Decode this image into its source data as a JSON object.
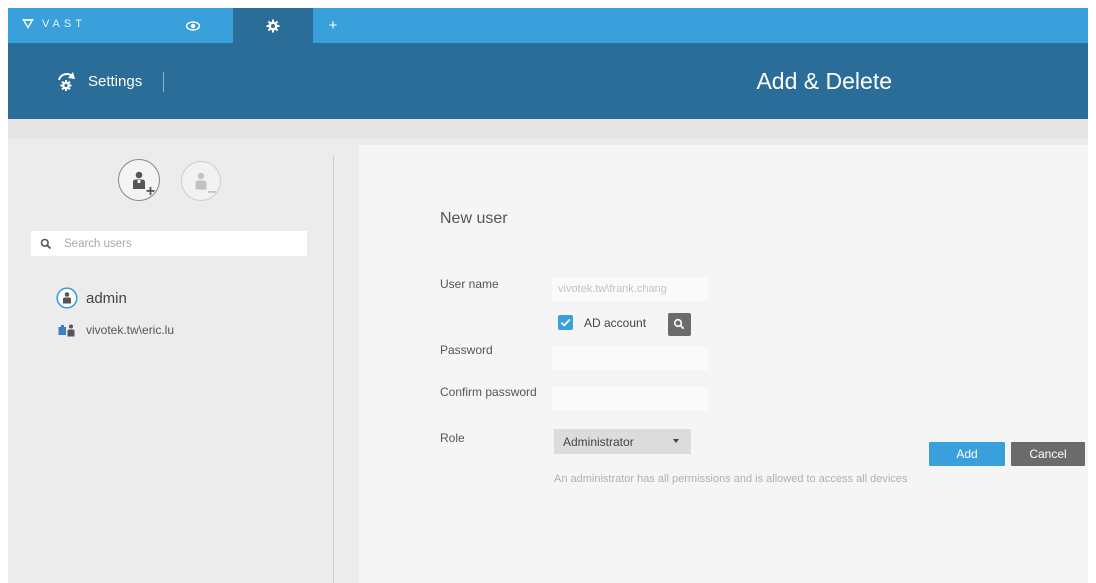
{
  "app": {
    "brand": "VAST"
  },
  "tabs": [
    {
      "name": "live-view",
      "icon": "eye-icon"
    },
    {
      "name": "settings",
      "icon": "gear-icon",
      "active": true
    },
    {
      "name": "new-tab",
      "icon": "plus-icon",
      "label": "+"
    }
  ],
  "header": {
    "section": "Settings",
    "title": "Add & Delete"
  },
  "sidebar": {
    "search_placeholder": "Search users",
    "users": [
      {
        "name": "admin",
        "icon": "user-circle-icon"
      },
      {
        "name": "vivotek.tw\\eric.lu",
        "icon": "ad-user-icon"
      }
    ]
  },
  "form": {
    "title": "New user",
    "username_label": "User name",
    "username_placeholder": "vivotek.tw\\frank.chang",
    "ad_account_label": "AD account",
    "ad_account_checked": true,
    "password_label": "Password",
    "confirm_label": "Confirm password",
    "role_label": "Role",
    "role_value": "Administrator",
    "role_description": "An administrator has all permissions and is allowed to access all devices",
    "add_label": "Add",
    "cancel_label": "Cancel"
  },
  "colors": {
    "topbar": "#3aa0dc",
    "header": "#2a6d99",
    "accent": "#3aa0dc",
    "secondary_button": "#6b6b6b"
  }
}
